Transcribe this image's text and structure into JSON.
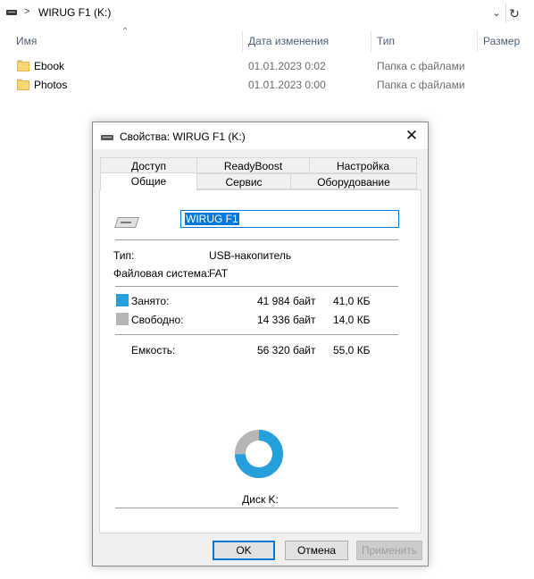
{
  "explorer": {
    "address_path": "WIRUG F1 (K:)",
    "address_separator": ">",
    "dropdown_icon": "chevron-down-icon",
    "refresh_icon": "refresh-icon",
    "columns": {
      "name": "Имя",
      "date": "Дата изменения",
      "type": "Тип",
      "size": "Размер"
    },
    "files": [
      {
        "name": "Ebook",
        "date": "01.01.2023 0:02",
        "type": "Папка с файлами"
      },
      {
        "name": "Photos",
        "date": "01.01.2023 0:00",
        "type": "Папка с файлами"
      }
    ]
  },
  "dialog": {
    "title": "Свойства: WIRUG F1 (K:)",
    "close_glyph": "✕",
    "tabs_row1": [
      "Доступ",
      "ReadyBoost",
      "Настройка"
    ],
    "tabs_row2": [
      "Общие",
      "Сервис",
      "Оборудование"
    ],
    "active_tab": "Общие",
    "volume_name": "WIRUG F1",
    "type_label": "Тип:",
    "type_value": "USB-накопитель",
    "fs_label": "Файловая система:",
    "fs_value": "FAT",
    "used": {
      "label": "Занято:",
      "bytes": "41 984 байт",
      "size": "41,0 КБ",
      "color": "#26a0da"
    },
    "free": {
      "label": "Свободно:",
      "bytes": "14 336 байт",
      "size": "14,0 КБ",
      "color": "#b5b5b5"
    },
    "capacity": {
      "label": "Емкость:",
      "bytes": "56 320 байт",
      "size": "55,0 КБ"
    },
    "used_fraction": 0.7455,
    "disk_label": "Диск K:",
    "buttons": {
      "ok": "OK",
      "cancel": "Отмена",
      "apply": "Применить"
    }
  }
}
